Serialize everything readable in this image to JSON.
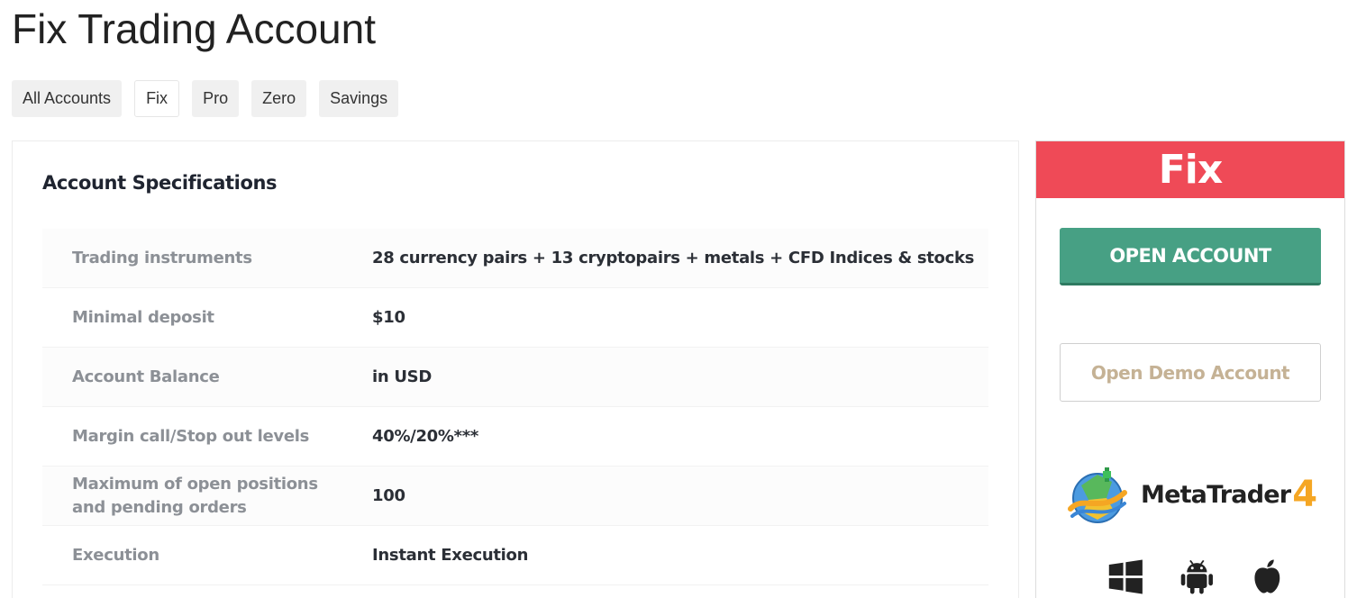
{
  "page": {
    "title": "Fix Trading Account"
  },
  "tabs": [
    {
      "label": "All Accounts",
      "active": false
    },
    {
      "label": "Fix",
      "active": true
    },
    {
      "label": "Pro",
      "active": false
    },
    {
      "label": "Zero",
      "active": false
    },
    {
      "label": "Savings",
      "active": false
    }
  ],
  "specs": {
    "heading": "Account Specifications",
    "rows": [
      {
        "label": "Trading instruments",
        "value": "28 currency pairs + 13 cryptopairs + metals + CFD Indices & stocks"
      },
      {
        "label": "Minimal deposit",
        "value": "$10"
      },
      {
        "label": "Account Balance",
        "value": "in USD"
      },
      {
        "label": "Margin call/Stop out levels",
        "value": "40%/20%***"
      },
      {
        "label": "Maximum of open positions and pending orders",
        "value": "100"
      },
      {
        "label": "Execution",
        "value": "Instant Execution"
      }
    ]
  },
  "side": {
    "title": "Fix",
    "open_account_label": "OPEN ACCOUNT",
    "open_demo_label": "Open Demo Account",
    "platform": {
      "name": "MetaTrader",
      "version": "4"
    },
    "platform_icons": [
      "windows-icon",
      "android-icon",
      "apple-icon"
    ]
  },
  "colors": {
    "header_red": "#ef4a57",
    "open_account_green": "#47a084",
    "demo_text_tan": "#c5b295",
    "label_gray": "#8c9096"
  }
}
